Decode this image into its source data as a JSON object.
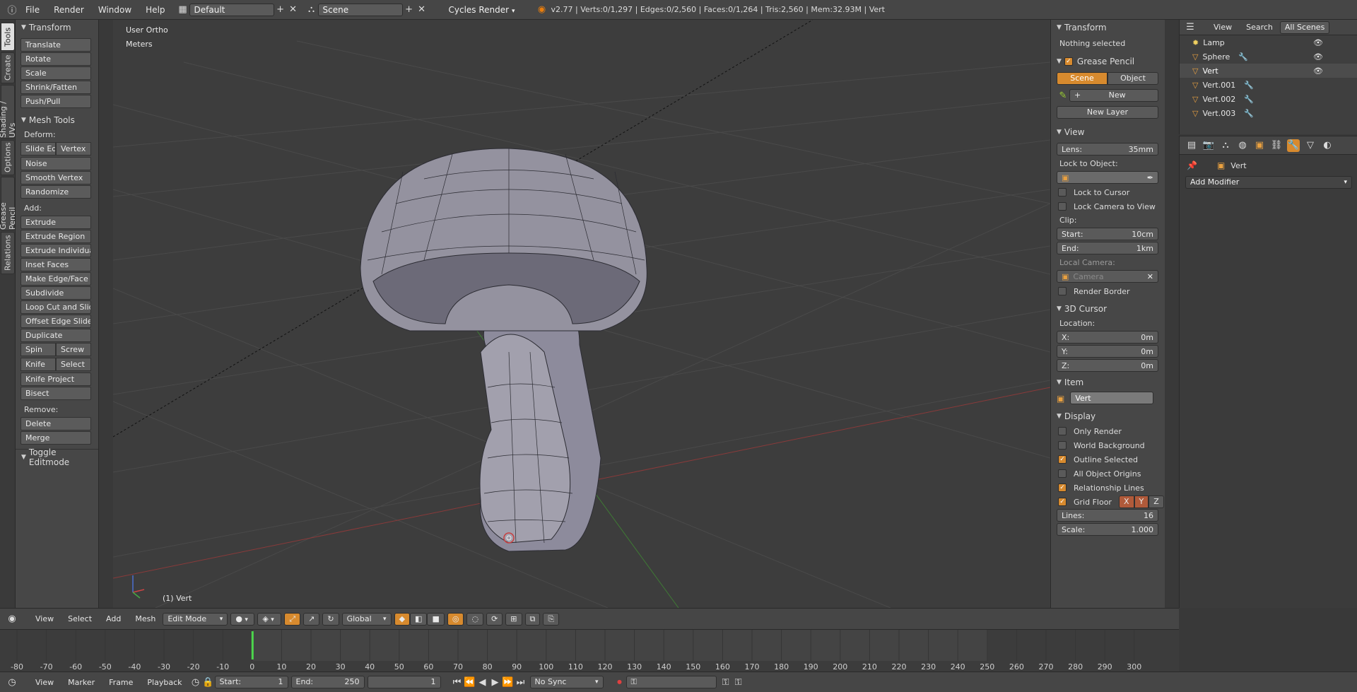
{
  "topbar": {
    "menus": [
      "File",
      "Render",
      "Window",
      "Help"
    ],
    "layout": "Default",
    "scene": "Scene",
    "engine": "Cycles Render",
    "stats": "v2.77 | Verts:0/1,297 | Edges:0/2,560 | Faces:0/1,264 | Tris:2,560 | Mem:32.93M | Vert"
  },
  "tabs": [
    "Tools",
    "Create",
    "Shading / UVs",
    "Options",
    "Grease Pencil",
    "Relations"
  ],
  "toolshelf": {
    "transform_title": "Transform",
    "transform_items": [
      "Translate",
      "Rotate",
      "Scale",
      "Shrink/Fatten",
      "Push/Pull"
    ],
    "meshtools_title": "Mesh Tools",
    "deform_label": "Deform:",
    "slide_edge": "Slide Ed",
    "vertex": "Vertex",
    "deform_items": [
      "Noise",
      "Smooth Vertex",
      "Randomize"
    ],
    "add_label": "Add:",
    "add_items": [
      "Extrude",
      "Extrude Region",
      "Extrude Individual",
      "Inset Faces",
      "Make Edge/Face",
      "Subdivide",
      "Loop Cut and Slide",
      "Offset Edge Slide",
      "Duplicate"
    ],
    "spin": "Spin",
    "screw": "Screw",
    "knife": "Knife",
    "select": "Select",
    "add_items2": [
      "Knife Project",
      "Bisect"
    ],
    "remove_label": "Remove:",
    "remove_items": [
      "Delete",
      "Merge"
    ],
    "toggle_editmode": "Toggle Editmode"
  },
  "viewport": {
    "view_name": "User Ortho",
    "units": "Meters",
    "object_label": "(1) Vert"
  },
  "npanel": {
    "transform_title": "Transform",
    "nothing_selected": "Nothing selected",
    "grease_title": "Grease Pencil",
    "scene_btn": "Scene",
    "object_btn": "Object",
    "new_btn": "New",
    "new_layer": "New Layer",
    "view_title": "View",
    "lens_label": "Lens:",
    "lens_value": "35mm",
    "lock_to_object": "Lock to Object:",
    "lock_to_cursor": "Lock to Cursor",
    "lock_camera": "Lock Camera to View",
    "clip_label": "Clip:",
    "start_label": "Start:",
    "start_value": "10cm",
    "end_label": "End:",
    "end_value": "1km",
    "local_camera": "Local Camera:",
    "camera_placeholder": "Camera",
    "render_border": "Render Border",
    "cursor_title": "3D Cursor",
    "location_label": "Location:",
    "x_label": "X:",
    "x_value": "0m",
    "y_label": "Y:",
    "y_value": "0m",
    "z_label": "Z:",
    "z_value": "0m",
    "item_title": "Item",
    "item_name": "Vert",
    "display_title": "Display",
    "only_render": "Only Render",
    "world_background": "World Background",
    "outline_selected": "Outline Selected",
    "all_origins": "All Object Origins",
    "relationship_lines": "Relationship Lines",
    "grid_floor": "Grid Floor",
    "axis_x": "X",
    "axis_y": "Y",
    "axis_z": "Z",
    "lines_label": "Lines:",
    "lines_value": "16",
    "scale_label": "Scale:",
    "scale_value": "1.000"
  },
  "outliner": {
    "view": "View",
    "search": "Search",
    "all_scenes": "All Scenes",
    "items": [
      "Lamp",
      "Sphere",
      "Vert",
      "Vert.001",
      "Vert.002",
      "Vert.003"
    ]
  },
  "props": {
    "object_name": "Vert",
    "add_modifier": "Add Modifier"
  },
  "vpheader": {
    "view": "View",
    "select": "Select",
    "add": "Add",
    "mesh": "Mesh",
    "mode": "Edit Mode",
    "orientation": "Global"
  },
  "timeline": {
    "ticks": [
      "-80",
      "-70",
      "-60",
      "-50",
      "-40",
      "-30",
      "-20",
      "-10",
      "0",
      "10",
      "20",
      "30",
      "40",
      "50",
      "60",
      "70",
      "80",
      "90",
      "100",
      "110",
      "120",
      "130",
      "140",
      "150",
      "160",
      "170",
      "180",
      "190",
      "200",
      "210",
      "220",
      "230",
      "240",
      "250",
      "260",
      "270",
      "280",
      "290",
      "300"
    ],
    "current_frame": 0,
    "range_end": 250
  },
  "tlheader": {
    "view": "View",
    "marker": "Marker",
    "frame": "Frame",
    "playback": "Playback",
    "start_label": "Start:",
    "start_value": "1",
    "end_label": "End:",
    "end_value": "250",
    "current": "1",
    "sync": "No Sync"
  },
  "colors": {
    "accent": "#d78a2e",
    "mesh": "#9a98a8",
    "x_axis": "#b04040",
    "y_axis": "#4f9a3f"
  }
}
